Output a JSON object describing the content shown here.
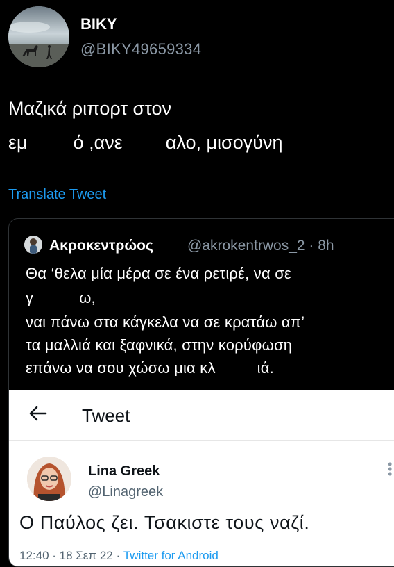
{
  "tweet": {
    "author_name": "BIKY",
    "author_handle": "@BIKY49659334",
    "line1": "Μαζικά ριπορτ στον",
    "line2_a": "εμ",
    "line2_b": "ό ,ανε",
    "line2_c": "αλο, μισογύνη",
    "translate_label": "Translate Tweet"
  },
  "quote": {
    "author_name": "Ακροκεντρώος",
    "author_handle": "@akrokentrwos_2 · 8h",
    "lines": [
      "Θα ‘θελα μία μέρα σε ένα ρετιρέ, να σε",
      "γ",
      "ναι πάνω στα κάγκελα να σε κρατάω απ’",
      "τα μαλλιά και ξαφνικά, στην κορύφωση",
      "επάνω να σου χώσω μια κλ"
    ],
    "line2_tail": "ω,",
    "line5_tail": "ιά."
  },
  "screenshot": {
    "title": "Tweet",
    "author_name": "Lina Greek",
    "author_handle": "@Linagreek",
    "text": "Ο Παύλος ζει. Τσακιστε τους ναζί.",
    "meta_time": "12:40 · 18 Σεπ 22 · ",
    "meta_source": "Twitter for Android"
  }
}
